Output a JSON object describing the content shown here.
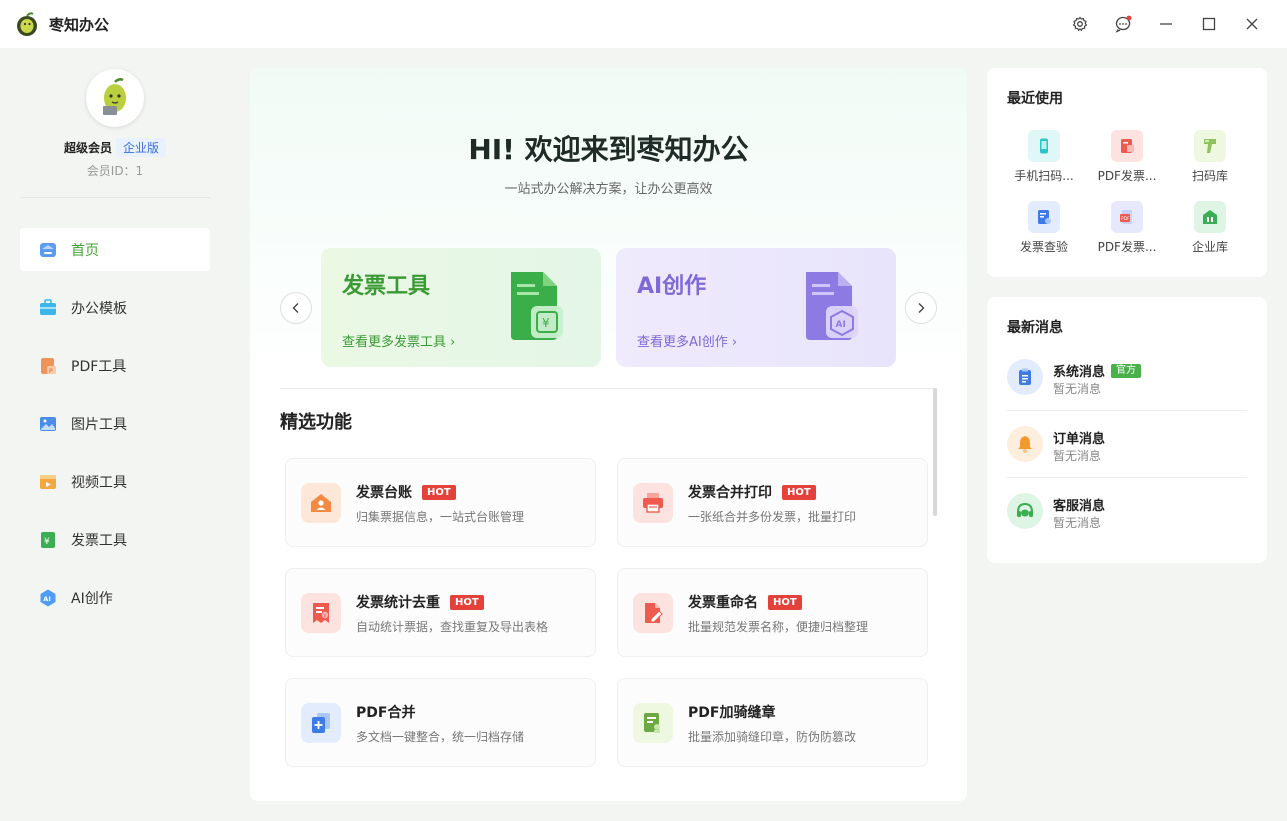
{
  "app": {
    "title": "枣知办公"
  },
  "sidebar": {
    "member_name": "超级会员",
    "member_badge": "企业版",
    "member_id": "会员ID：1",
    "items": [
      {
        "label": "首页",
        "icon": "home-icon"
      },
      {
        "label": "办公模板",
        "icon": "briefcase-icon"
      },
      {
        "label": "PDF工具",
        "icon": "pdf-icon"
      },
      {
        "label": "图片工具",
        "icon": "image-icon"
      },
      {
        "label": "视频工具",
        "icon": "video-icon"
      },
      {
        "label": "发票工具",
        "icon": "invoice-icon"
      },
      {
        "label": "AI创作",
        "icon": "ai-icon"
      }
    ]
  },
  "main": {
    "hero_title": "HI! 欢迎来到枣知办公",
    "hero_subtitle": "一站式办公解决方案，让办公更高效",
    "banners": [
      {
        "title": "发票工具",
        "link": "查看更多发票工具",
        "color": "#3a9a34"
      },
      {
        "title": "AI创作",
        "link": "查看更多AI创作",
        "color": "#7c6ad6"
      }
    ],
    "section_title": "精选功能",
    "features": [
      {
        "name": "发票台账",
        "hot": "HOT",
        "desc": "归集票据信息，一站式台账管理"
      },
      {
        "name": "发票合并打印",
        "hot": "HOT",
        "desc": "一张纸合并多份发票，批量打印"
      },
      {
        "name": "发票统计去重",
        "hot": "HOT",
        "desc": "自动统计票据，查找重复及导出表格"
      },
      {
        "name": "发票重命名",
        "hot": "HOT",
        "desc": "批量规范发票名称，便捷归档整理"
      },
      {
        "name": "PDF合并",
        "desc": "多文档一键整合，统一归档存储"
      },
      {
        "name": "PDF加骑缝章",
        "desc": "批量添加骑缝印章，防伪防篡改"
      }
    ]
  },
  "recent": {
    "title": "最近使用",
    "items": [
      {
        "label": "手机扫码...",
        "icon": "phone-scan-icon"
      },
      {
        "label": "PDF发票...",
        "icon": "pdf-invoice-icon"
      },
      {
        "label": "扫码库",
        "icon": "scanner-gun-icon"
      },
      {
        "label": "发票查验",
        "icon": "invoice-check-icon"
      },
      {
        "label": "PDF发票...",
        "icon": "pdf-doc-icon"
      },
      {
        "label": "企业库",
        "icon": "building-icon"
      }
    ]
  },
  "messages": {
    "title": "最新消息",
    "items": [
      {
        "title": "系统消息",
        "badge": "官方",
        "sub": "暂无消息"
      },
      {
        "title": "订单消息",
        "sub": "暂无消息"
      },
      {
        "title": "客服消息",
        "sub": "暂无消息"
      }
    ]
  },
  "colors": {
    "accent": "#42a135",
    "hot": "#e5413b",
    "official": "#49b04a",
    "member_badge": "#3a6fd8"
  }
}
